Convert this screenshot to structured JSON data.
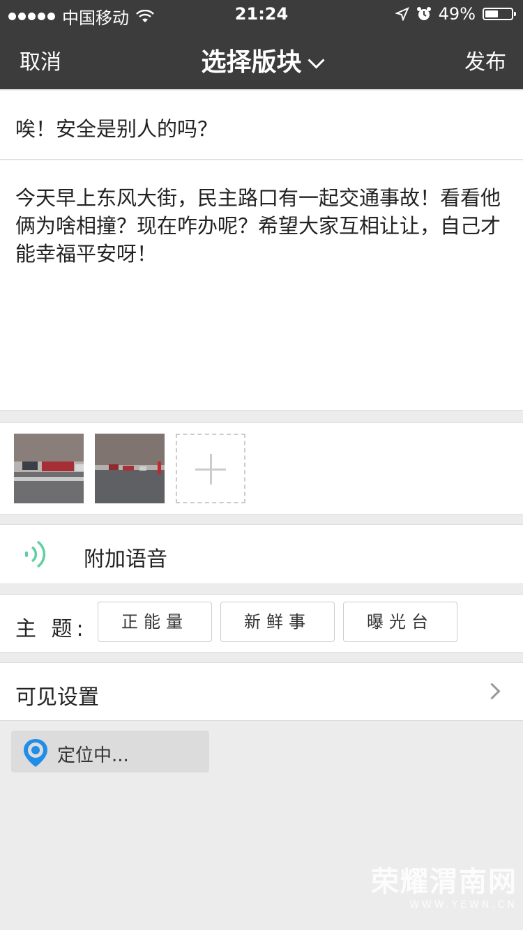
{
  "status_bar": {
    "carrier": "中国移动",
    "time": "21:24",
    "battery": "49%"
  },
  "nav": {
    "cancel": "取消",
    "title": "选择版块",
    "publish": "发布"
  },
  "post": {
    "title": "唉！安全是别人的吗？",
    "body": "今天早上东风大街，民主路口有一起交通事故！看看他俩为啥相撞？现在咋办呢？希望大家互相让让，自己才能幸福平安呀！"
  },
  "voice": {
    "label": "附加语音"
  },
  "topics": {
    "label": "主 题:",
    "options": [
      "正能量",
      "新鲜事",
      "曝光台"
    ]
  },
  "visibility": {
    "label": "可见设置"
  },
  "location": {
    "label": "定位中..."
  },
  "watermark": {
    "name": "荣耀渭南网",
    "url": "WWW.YEWN.CN"
  },
  "colors": {
    "nav_bg": "#3c3c3c",
    "voice_accent": "#5fcf9e",
    "location_pin": "#1e8ee8"
  }
}
